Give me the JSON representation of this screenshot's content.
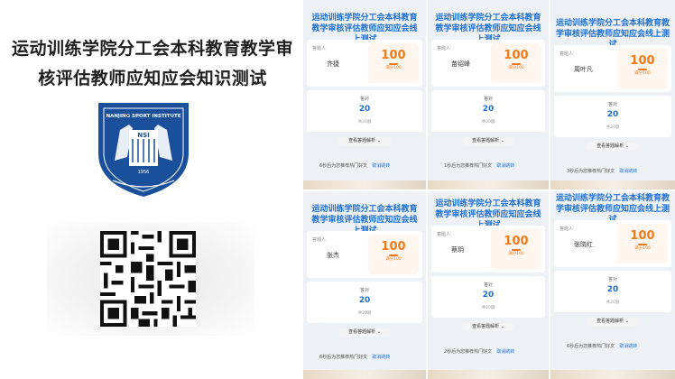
{
  "promo": {
    "title_line1": "运动训练学院分工会本科教育教学审",
    "title_line2": "核评估教师应知应会知识测试",
    "logo_text": "NANJING SPORT INSTITUTE",
    "logo_abbr": "NSI",
    "logo_year": "1956"
  },
  "shots": [
    {
      "title": "运动训练学院分工会本科教育教学审核评估教师应知应会线上测试",
      "name_label": "答题人",
      "name": "齐捷",
      "score": "100",
      "score_sub": "满分100",
      "answer_label": "答对",
      "answer": "20",
      "answer_sub": "共20题",
      "view_btn": "查看答题解析",
      "footer": "6秒后为您推荐热门好文",
      "footer_link": "取消跳转"
    },
    {
      "title": "运动训练学院分工会本科教育教学审核评估教师应知应会线上测试",
      "name_label": "答题人",
      "name": "苗绍峰",
      "score": "100",
      "score_sub": "满分100",
      "answer_label": "答对",
      "answer": "20",
      "answer_sub": "共20题",
      "view_btn": "查看答题解析",
      "footer": "1秒后为您推荐热门好文",
      "footer_link": "取消跳转"
    },
    {
      "title": "运动训练学院分工会本科教育教学审核评估教师应知应会线上测试",
      "name_label": "答题人",
      "name": "周叶凡",
      "score": "100",
      "score_sub": "满分100",
      "answer_label": "答对",
      "answer": "20",
      "answer_sub": "共20题",
      "view_btn": "查看答题解析",
      "footer": "3秒后为您推荐热门好文",
      "footer_link": "取消跳转"
    },
    {
      "title": "运动训练学院分工会本科教育教学审核评估教师应知应会线上测试",
      "name_label": "答题人",
      "name": "张杰",
      "score": "100",
      "score_sub": "满分100",
      "answer_label": "答对",
      "answer": "20",
      "answer_sub": "共20题",
      "view_btn": "查看答题解析",
      "footer": "6秒后为您推荐热门好文",
      "footer_link": "取消跳转"
    },
    {
      "title": "运动训练学院分工会本科教育教学审核评估教师应知应会线上测试",
      "name_label": "答题人",
      "name": "蔡玥",
      "score": "100",
      "score_sub": "满分100",
      "answer_label": "答对",
      "answer": "20",
      "answer_sub": "共20题",
      "view_btn": "查看答题解析",
      "footer": "2秒后为您推荐热门好文",
      "footer_link": "取消跳转"
    },
    {
      "title": "运动训练学院分工会本科教育教学审核评估教师应知应会线上测试",
      "name_label": "答题人",
      "name": "张晓红",
      "score": "100",
      "score_sub": "满分100",
      "answer_label": "答对",
      "answer": "20",
      "answer_sub": "共20题",
      "view_btn": "查看答题解析",
      "footer": "6秒后为您推荐热门好文",
      "footer_link": "取消跳转"
    }
  ],
  "colors": {
    "accent": "#1d6fd6",
    "score": "#f07a1a",
    "logo_blue": "#1a4f9c"
  }
}
